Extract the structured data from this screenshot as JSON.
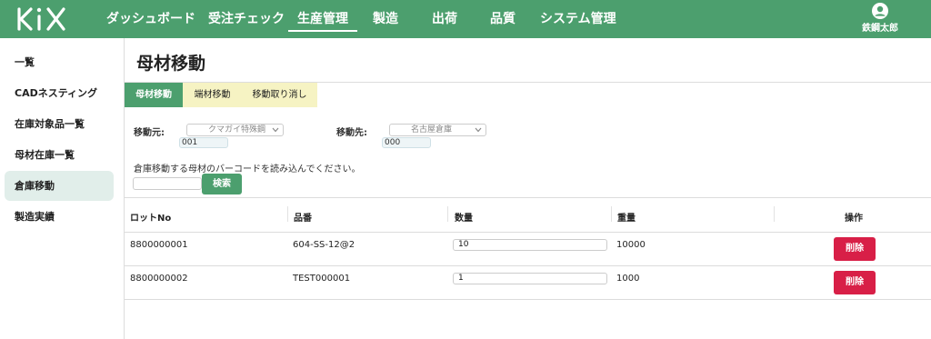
{
  "header": {
    "logo_text": "KiX",
    "nav": [
      "ダッシュボード",
      "受注チェック",
      "生産管理",
      "製造",
      "出荷",
      "品質",
      "システム管理"
    ],
    "active_nav": "生産管理",
    "user_name": "鉄鋼太郎"
  },
  "sidebar": {
    "items": [
      "一覧",
      "CADネスティング",
      "在庫対象品一覧",
      "母材在庫一覧",
      "倉庫移動",
      "製造実績"
    ],
    "active_item": "倉庫移動"
  },
  "page": {
    "title": "母材移動",
    "tabs": [
      "母材移動",
      "端材移動",
      "移動取り消し"
    ],
    "active_tab": "母材移動"
  },
  "form": {
    "from_label": "移動元:",
    "from_value": "クマガイ特殊鋼",
    "from_code": "001",
    "to_label": "移動先:",
    "to_value": "名古屋倉庫",
    "to_code": "000",
    "instruction": "倉庫移動する母材のバーコードを読み込んでください。",
    "barcode_value": "",
    "search_label": "検索"
  },
  "table": {
    "headers": [
      "ロットNo",
      "品番",
      "数量",
      "重量",
      "操作"
    ],
    "rows": [
      {
        "lot": "8800000001",
        "part": "604-SS-12@2",
        "qty": "10",
        "weight": "10000",
        "action": "削除"
      },
      {
        "lot": "8800000002",
        "part": "TEST000001",
        "qty": "1",
        "weight": "1000",
        "action": "削除"
      }
    ]
  },
  "colors": {
    "brand": "#4c9f6e",
    "tab_inactive": "#f6f3c3",
    "sidebar_active": "#e1eeea",
    "delete": "#d81f47"
  },
  "icons": [
    "kix-logo",
    "user-icon",
    "chevron-down-icon"
  ]
}
